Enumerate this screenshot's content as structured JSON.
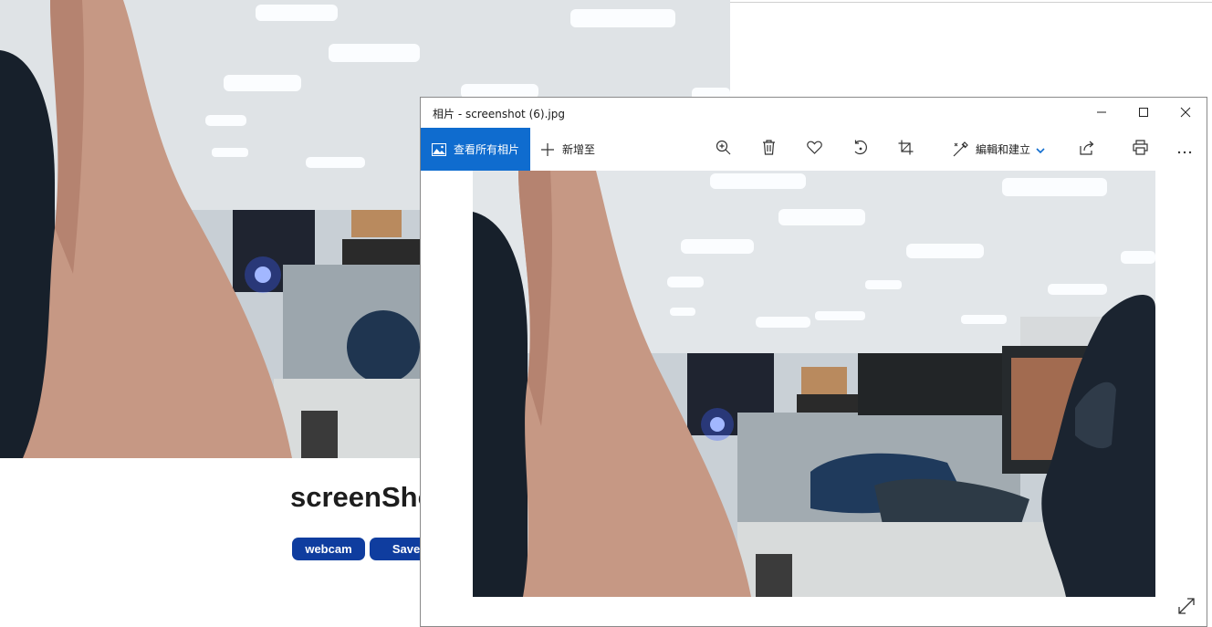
{
  "page": {
    "heading": "screenShot",
    "buttons": {
      "webcam": "webcam",
      "save": "Save"
    }
  },
  "window": {
    "title": "相片 - screenshot (6).jpg",
    "controls": {
      "minimize": "minimize-icon",
      "maximize": "maximize-icon",
      "close": "close-icon"
    }
  },
  "toolbar": {
    "view_all": "查看所有相片",
    "add_to": "新增至",
    "edit_create": "編輯和建立",
    "icons": [
      "zoom-in-icon",
      "delete-icon",
      "favorite-icon",
      "rotate-icon",
      "crop-icon",
      "share-icon",
      "print-icon",
      "more-icon"
    ]
  },
  "colors": {
    "accent": "#0f6ccf",
    "page_button": "#0f3d9f"
  }
}
